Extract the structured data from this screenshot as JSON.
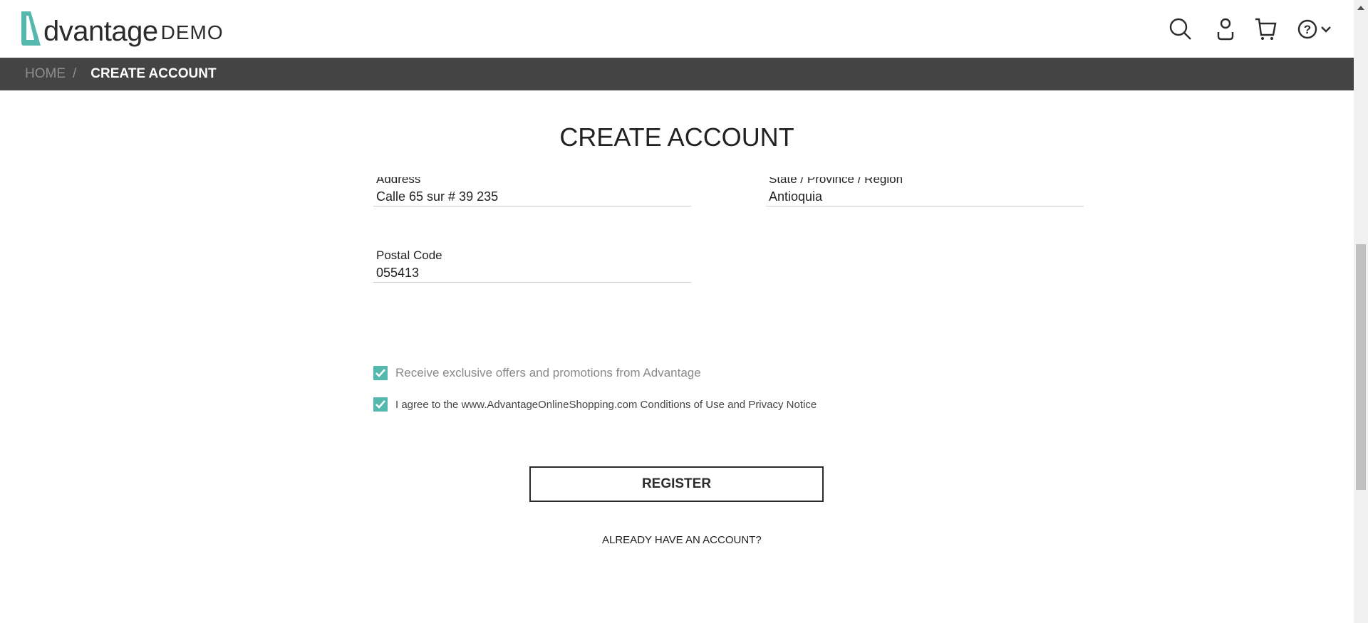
{
  "header": {
    "logo_word": "dvantage",
    "logo_demo": "DEMO",
    "icons": [
      "search-icon",
      "user-icon",
      "cart-icon",
      "help-icon",
      "chevron-down-icon"
    ]
  },
  "breadcrumb": {
    "home": "HOME",
    "separator": "/",
    "current": "CREATE ACCOUNT"
  },
  "page": {
    "title": "CREATE ACCOUNT"
  },
  "fields": {
    "address": {
      "label": "Address",
      "value": "Calle 65 sur # 39 235"
    },
    "state": {
      "label": "State / Province / Region",
      "value": "Antioquia"
    },
    "postal": {
      "label": "Postal Code",
      "value": "055413"
    }
  },
  "checkboxes": [
    {
      "label": "Receive exclusive offers and promotions from Advantage",
      "checked": true
    },
    {
      "label": "I agree to the www.AdvantageOnlineShopping.com Conditions of Use and Privacy Notice",
      "checked": true
    }
  ],
  "register_label": "REGISTER",
  "already_label": "ALREADY HAVE AN ACCOUNT?",
  "colors": {
    "accent": "#54b8ae",
    "breadcrumb_bg": "#444444"
  }
}
